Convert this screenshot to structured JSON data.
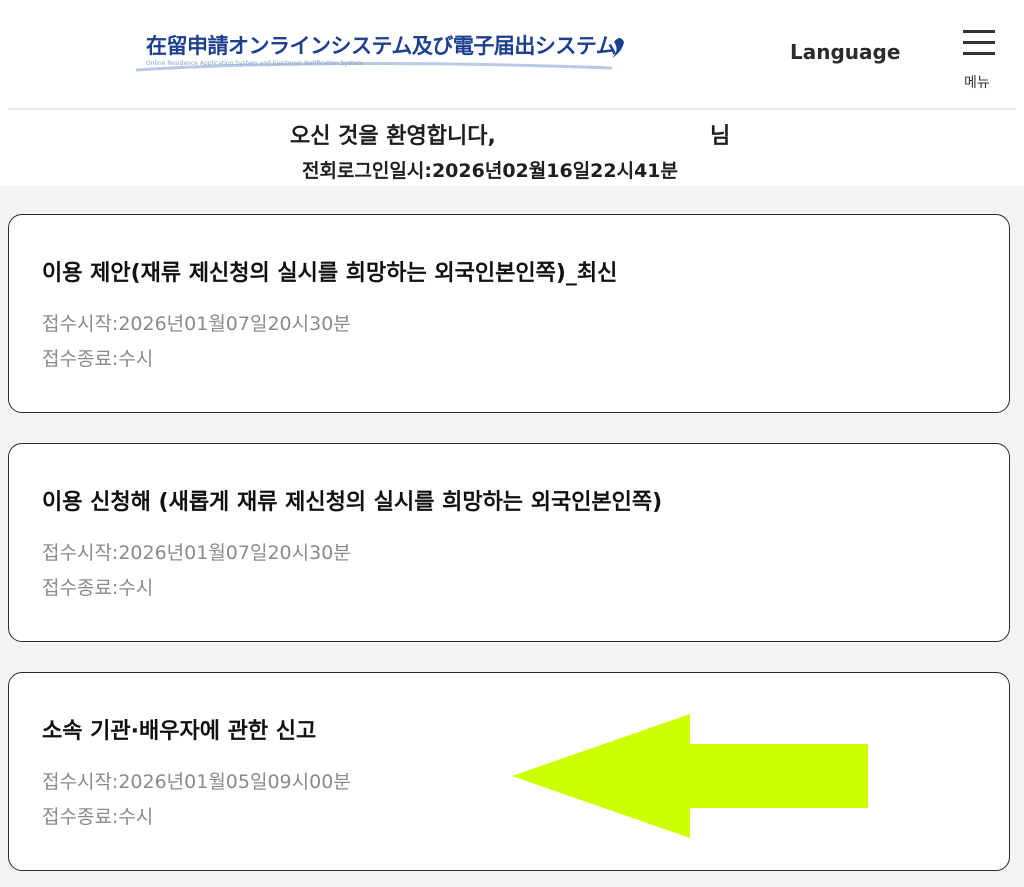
{
  "header": {
    "logo_title": "在留申請オンラインシステム及び電子届出システム",
    "logo_subtitle": "Online Residence Application System and Electronic Notification System",
    "language_label": "Language",
    "menu_label": "메뉴",
    "menu_icon": "hamburger-icon"
  },
  "welcome": {
    "greeting": "오신 것을 환영합니다,",
    "honorific": "님",
    "last_login": "전회로그인일시:2026년02월16일22시41분"
  },
  "cards": [
    {
      "title": "이용 제안(재류 제신청의 실시를 희망하는 외국인본인쪽)_최신",
      "start": "접수시작:2026년01월07일20시30분",
      "end": "접수종료:수시"
    },
    {
      "title": "이용 신청해 (새롭게 재류 제신청의 실시를 희망하는 외국인본인쪽)",
      "start": "접수시작:2026년01월07일20시30분",
      "end": "접수종료:수시"
    },
    {
      "title": "소속 기관·배우자에 관한 신고",
      "start": "접수시작:2026년01월05일09시00분",
      "end": "접수종료:수시"
    }
  ],
  "annotation": {
    "icon": "arrow-left-icon",
    "color": "#ccff00"
  }
}
